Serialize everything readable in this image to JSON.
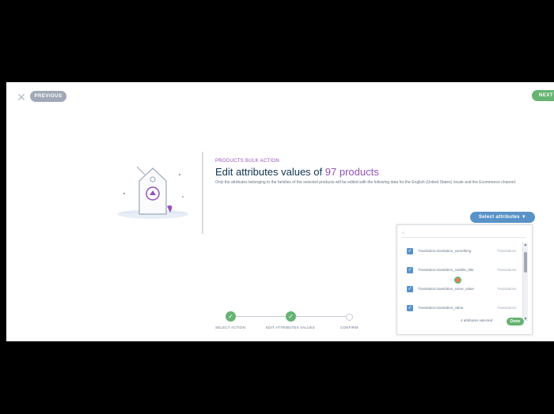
{
  "header": {
    "previous_label": "Previous",
    "next_label": "Next"
  },
  "main": {
    "breadcrumb": "Products bulk action",
    "title_prefix": "Edit attributes values of",
    "title_count": "97 products",
    "subtitle": "Only the attributes belonging to the families of the selected products will be edited with the following data for the English (United States) locale and the Ecommerce channel.",
    "select_attributes_label": "Select attributes"
  },
  "attribute_panel": {
    "search_placeholder": "",
    "items": [
      {
        "code": "Translation.translation_something",
        "group": "Translations",
        "checked": true
      },
      {
        "code": "Translation.translation_subtitle_title",
        "group": "Translations",
        "checked": true
      },
      {
        "code": "Translation.translation_some_value",
        "group": "Translations",
        "checked": true
      },
      {
        "code": "Translation.translation_value",
        "group": "Translations",
        "checked": true
      }
    ],
    "selected_count": "4 attributes selected",
    "done_label": "Done"
  },
  "steps": [
    {
      "label": "Select action",
      "state": "done"
    },
    {
      "label": "Edit attributes values",
      "state": "done"
    },
    {
      "label": "Confirm",
      "state": "pending"
    }
  ],
  "colors": {
    "accent_purple": "#9452ba",
    "success_green": "#67b373",
    "primary_blue": "#5992c7",
    "text_dark": "#11324d",
    "grey": "#a1a9b7"
  },
  "icons": [
    "close-icon",
    "chevron-down-icon",
    "check-icon",
    "tag-illustration"
  ]
}
